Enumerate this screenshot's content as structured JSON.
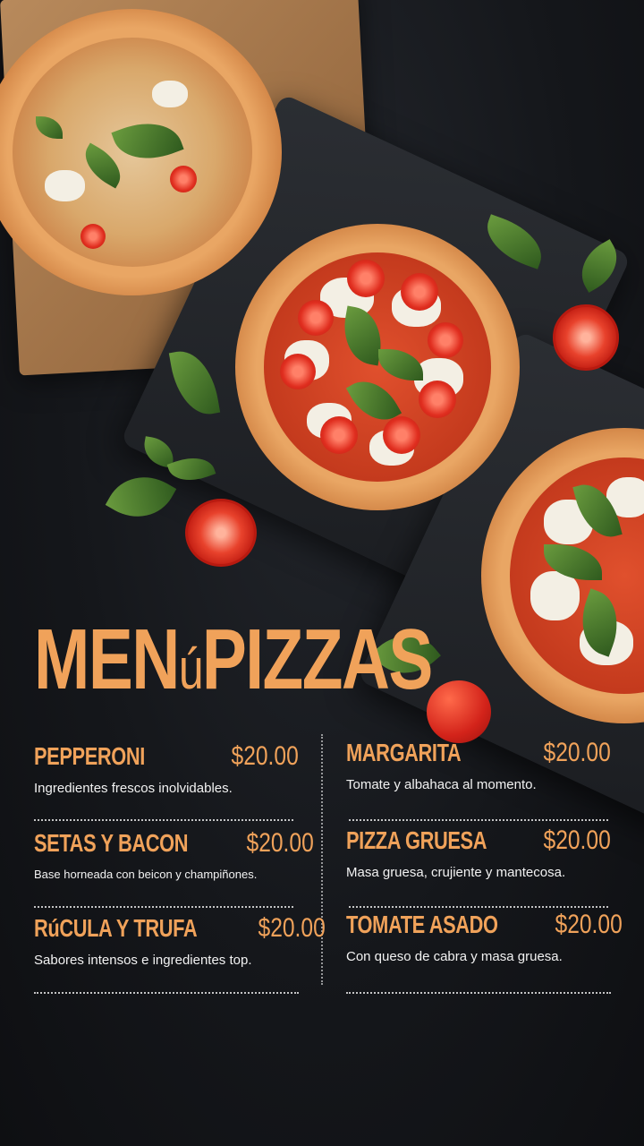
{
  "title": {
    "part1": "MEN",
    "accent": "ú",
    "part2": "PIZZAS"
  },
  "colors": {
    "accent": "#f0a25a",
    "background": "#15171b",
    "text": "#f2f2f2"
  },
  "menu": {
    "left": [
      {
        "name": "PEPPERONI",
        "price": "$20.00",
        "description": "Ingredientes frescos inolvidables."
      },
      {
        "name": "SETAS Y BACON",
        "price": "$20.00",
        "description": "Base horneada con beicon y champiñones."
      },
      {
        "name": "RúCULA Y TRUFA",
        "price": "$20.00",
        "description": "Sabores intensos e ingredientes top."
      }
    ],
    "right": [
      {
        "name": "MARGARITA",
        "price": "$20.00",
        "description": "Tomate y albahaca al momento."
      },
      {
        "name": "PIZZA GRUESA",
        "price": "$20.00",
        "description": "Masa gruesa, crujiente y mantecosa."
      },
      {
        "name": "TOMATE ASADO",
        "price": "$20.00",
        "description": "Con queso de cabra y masa gruesa."
      }
    ]
  }
}
